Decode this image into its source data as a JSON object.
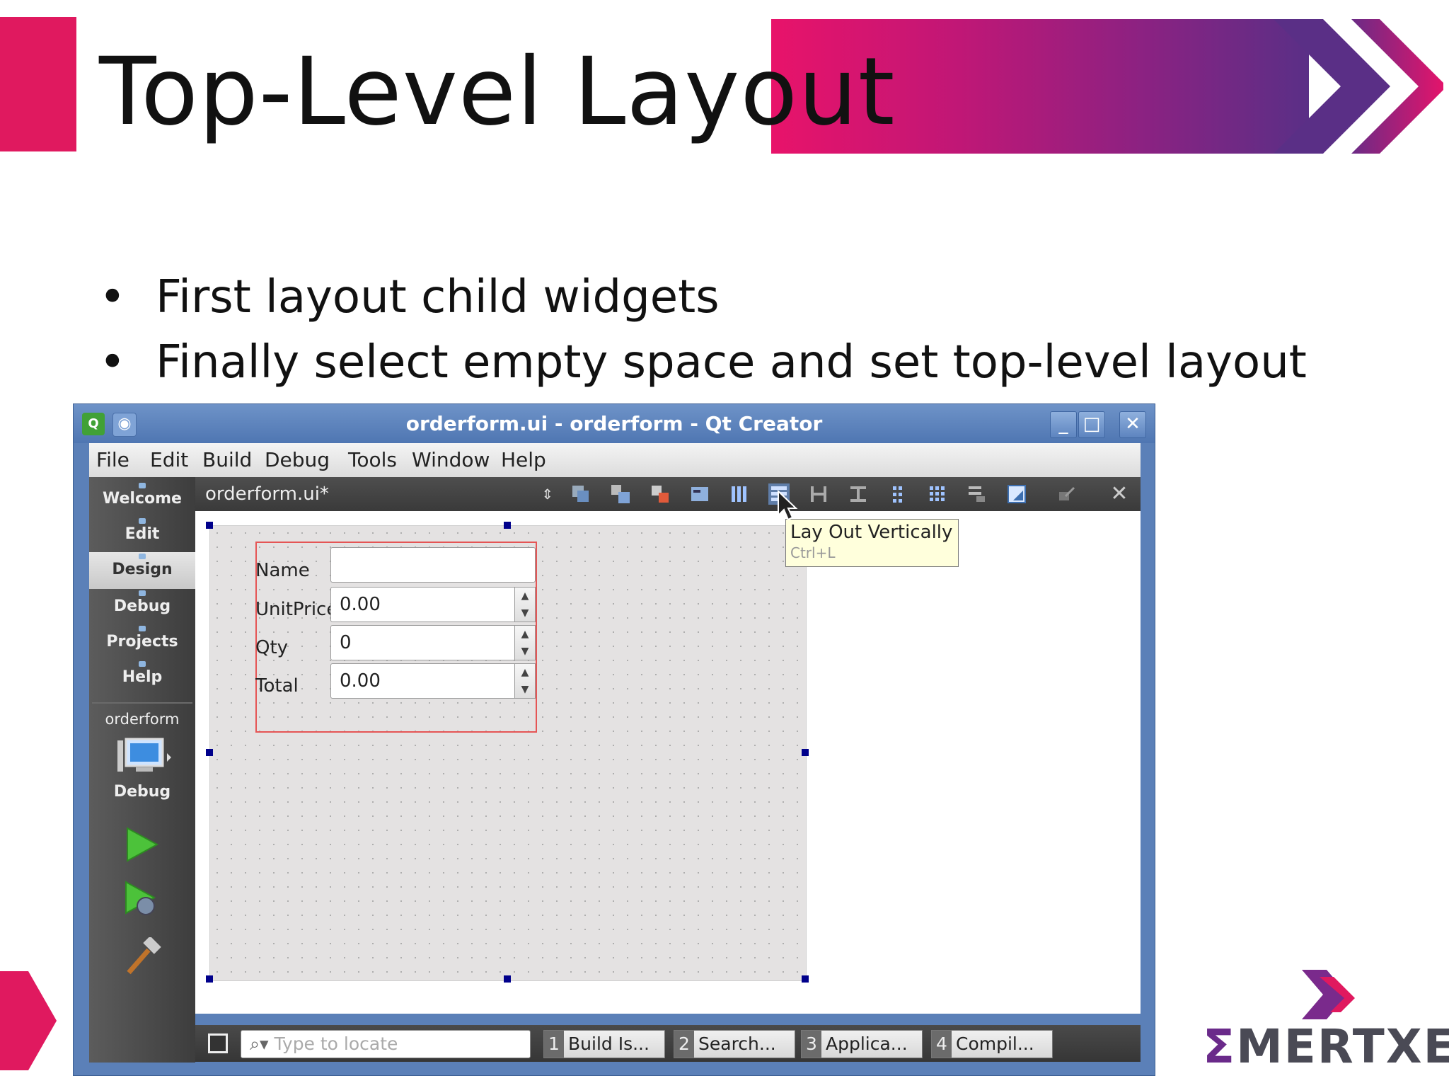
{
  "slide": {
    "title": "Top-Level Layout",
    "bullets": [
      "First layout child widgets",
      "Finally select empty space and set top-level layout"
    ],
    "bullet_glyph": "•",
    "logo_text": "MERTXE",
    "logo_sigma": "Σ"
  },
  "colors": {
    "accent": "#e0195f",
    "banner_start": "#e8136a",
    "banner_end": "#5a2f86",
    "window_frame": "#5b80b8"
  },
  "window": {
    "title": "orderform.ui - orderform - Qt Creator",
    "app_icon": "Q",
    "controls": {
      "minimize": "_",
      "maximize": "□",
      "close": "✕"
    },
    "menu": [
      "File",
      "Edit",
      "Build",
      "Debug",
      "Tools",
      "Window",
      "Help"
    ],
    "modes": [
      "Welcome",
      "Edit",
      "Design",
      "Debug",
      "Projects",
      "Help"
    ],
    "active_mode": "Design",
    "project": "orderform",
    "run_config": "Debug",
    "editor": {
      "file": "orderform.ui*",
      "combo_arrows": "⇕",
      "close": "✕"
    },
    "toolbar_icons": [
      "edit-widgets-icon",
      "edit-signals-icon",
      "edit-buddies-icon",
      "edit-tab-order-icon",
      "lay-out-horizontally-icon",
      "lay-out-vertically-icon",
      "lay-out-horizontal-splitter-icon",
      "lay-out-vertical-splitter-icon",
      "lay-out-form-icon",
      "lay-out-grid-icon",
      "break-layout-icon",
      "adjust-size-icon",
      "preview-icon"
    ],
    "form": {
      "fields": [
        {
          "label": "Name",
          "value": "",
          "spin": false
        },
        {
          "label": "UnitPrice",
          "value": "0.00",
          "spin": true
        },
        {
          "label": "Qty",
          "value": "0",
          "spin": true
        },
        {
          "label": "Total",
          "value": "0.00",
          "spin": true
        }
      ]
    },
    "tooltip": {
      "title": "Lay Out Vertically",
      "shortcut": "Ctrl+L"
    },
    "bottom": {
      "locator_placeholder": "Type to locate",
      "locator_icon": "⌕▾",
      "tabs": [
        {
          "num": "1",
          "label": "Build Is..."
        },
        {
          "num": "2",
          "label": "Search..."
        },
        {
          "num": "3",
          "label": "Applica..."
        },
        {
          "num": "4",
          "label": "Compil..."
        }
      ]
    }
  }
}
